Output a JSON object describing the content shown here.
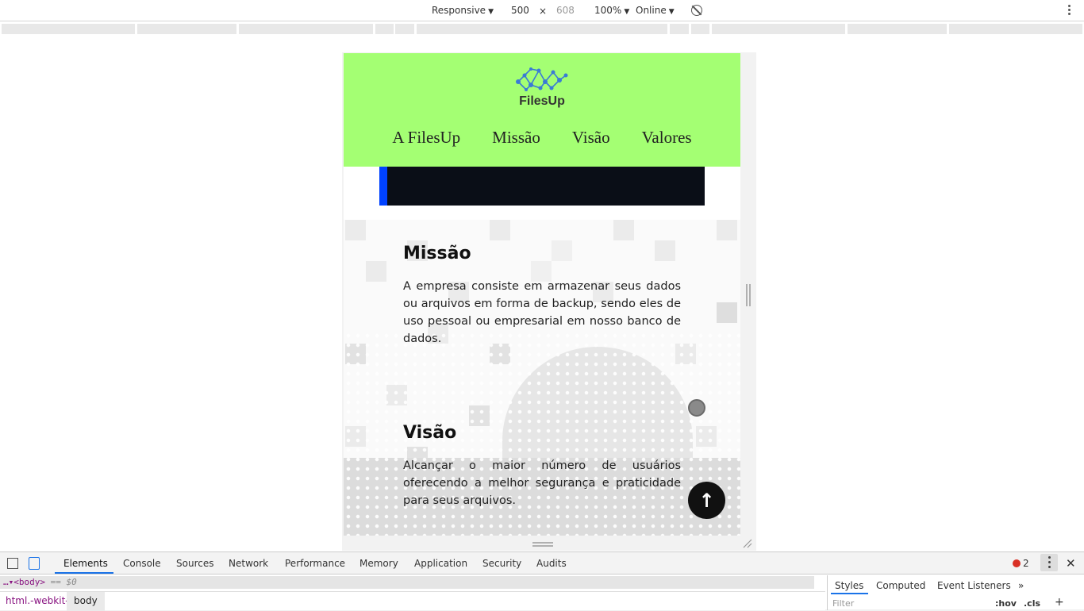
{
  "device_toolbar": {
    "device": "Responsive",
    "width": "500",
    "times": "×",
    "height": "608",
    "zoom": "100%",
    "network": "Online"
  },
  "site": {
    "logo_text": "FilesUp",
    "nav": [
      "A FilesUp",
      "Missão",
      "Visão",
      "Valores"
    ],
    "sections": [
      {
        "title": "Missão",
        "text": "A empresa consiste em armazenar seus dados ou arquivos em forma de backup, sendo eles de uso pessoal ou empresarial em nosso banco de dados."
      },
      {
        "title": "Visão",
        "text": "Alcançar o maior número de usuários oferecendo a melhor segurança e praticidade para seus arquivos."
      }
    ],
    "scroll_top_glyph": "↑",
    "colors": {
      "header": "#a4ff73",
      "accent": "#0042ff",
      "card": "#0a0e17"
    }
  },
  "devtools": {
    "tabs": [
      "Elements",
      "Console",
      "Sources",
      "Network",
      "Performance",
      "Memory",
      "Application",
      "Security",
      "Audits"
    ],
    "error_count": "2",
    "dom_line_tag": "<body>",
    "dom_line_ref": "== $0",
    "breadcrumbs": [
      "html.-webkit-",
      "body"
    ],
    "styles_tabs": [
      "Styles",
      "Computed",
      "Event Listeners"
    ],
    "filter_placeholder": "Filter",
    "hov": ":hov",
    "cls": ".cls",
    "plus": "+"
  }
}
